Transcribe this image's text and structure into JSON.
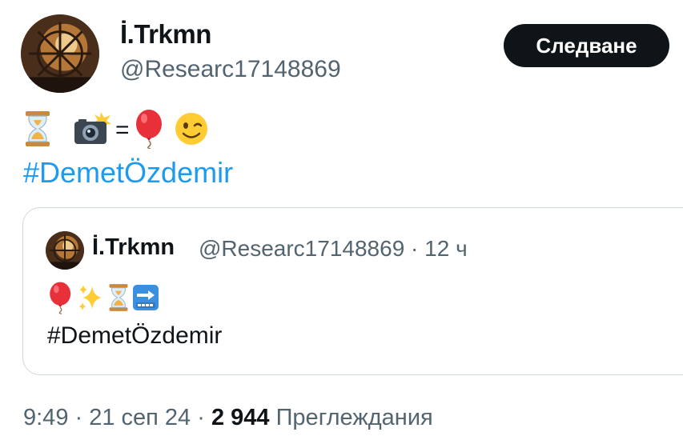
{
  "author": {
    "name": "İ.Trkmn",
    "handle": "@Researc17148869"
  },
  "follow_button": {
    "label": "Следване"
  },
  "post": {
    "emoji_icons": [
      "hourglass-icon",
      "camera-flash-icon",
      "balloon-icon",
      "winking-face-icon"
    ],
    "equals_text": "=",
    "hashtag": "#DemetÖzdemir"
  },
  "quoted": {
    "name": "İ.Trkmn",
    "handle_time": "@Researc17148869 · 12 ч",
    "emoji_icons": [
      "balloon-icon",
      "sparkles-icon",
      "hourglass-icon",
      "soon-arrow-icon"
    ],
    "hashtag": "#DemetÖzdemir"
  },
  "footer": {
    "time_date": "9:49 · 21 сеп 24 · ",
    "views_count": "2 944",
    "views_label": " Преглеждания"
  },
  "colors": {
    "link": "#1d9bf0",
    "button_bg": "#0f1419",
    "secondary_text": "#536471",
    "border": "#cfd9de"
  }
}
